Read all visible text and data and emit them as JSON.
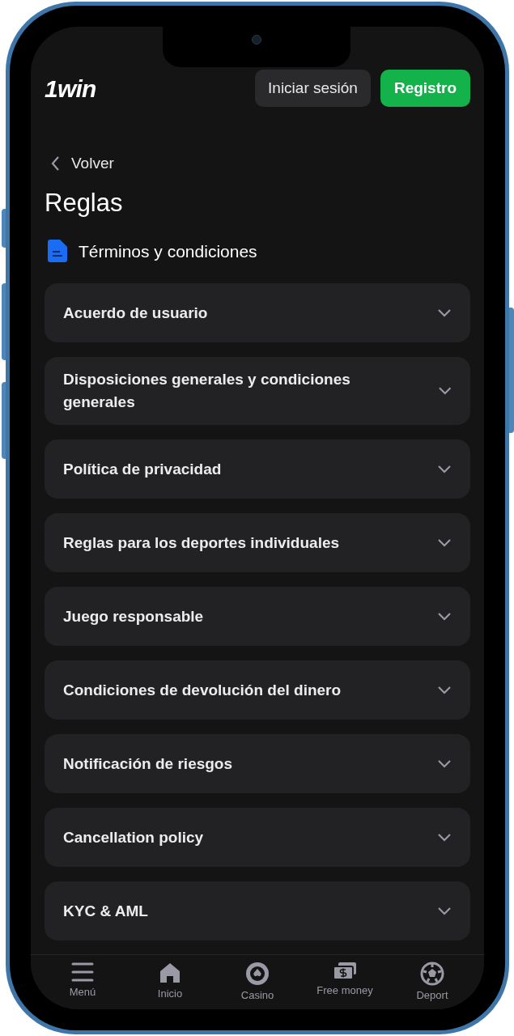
{
  "header": {
    "logo": "1win",
    "login_button": "Iniciar sesión",
    "register_button": "Registro"
  },
  "back_link": "Volver",
  "title": "Reglas",
  "section": {
    "title": "Términos y condiciones"
  },
  "items": [
    {
      "label": "Acuerdo de usuario",
      "expanded": false
    },
    {
      "label": "Disposiciones generales y condiciones generales",
      "expanded": false
    },
    {
      "label": "Política de privacidad",
      "expanded": false
    },
    {
      "label": "Reglas para los deportes individuales",
      "expanded": false
    },
    {
      "label": "Juego responsable",
      "expanded": false
    },
    {
      "label": "Condiciones de devolución del dinero",
      "expanded": false
    },
    {
      "label": "Notificación de riesgos",
      "expanded": false
    },
    {
      "label": "Cancellation policy",
      "expanded": false
    },
    {
      "label": "KYC & AML",
      "expanded": false
    }
  ],
  "bottom_nav": [
    {
      "kind": "menu",
      "label": "Menú"
    },
    {
      "kind": "home",
      "label": "Inicio"
    },
    {
      "kind": "casino",
      "label": "Casino"
    },
    {
      "kind": "money",
      "label": "Free money"
    },
    {
      "kind": "sport",
      "label": "Deport"
    }
  ]
}
